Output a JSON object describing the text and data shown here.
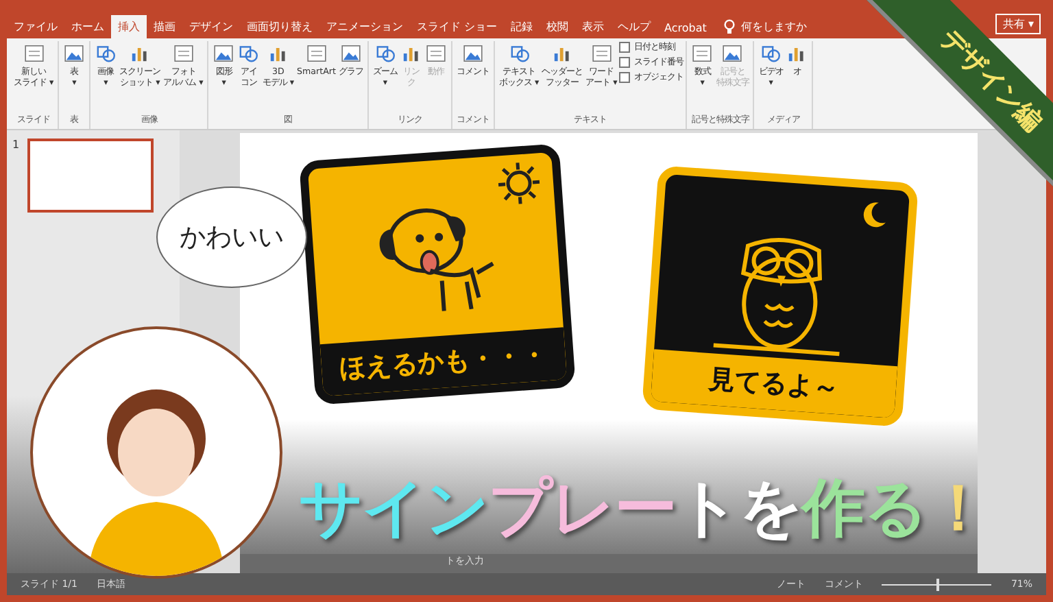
{
  "window": {
    "tell_me": "何をしますか",
    "share_button": "共有 ▾"
  },
  "tabs": [
    {
      "label": "ファイル",
      "selected": false
    },
    {
      "label": "ホーム",
      "selected": false
    },
    {
      "label": "挿入",
      "selected": true
    },
    {
      "label": "描画",
      "selected": false
    },
    {
      "label": "デザイン",
      "selected": false
    },
    {
      "label": "画面切り替え",
      "selected": false
    },
    {
      "label": "アニメーション",
      "selected": false
    },
    {
      "label": "スライド ショー",
      "selected": false
    },
    {
      "label": "記録",
      "selected": false
    },
    {
      "label": "校閲",
      "selected": false
    },
    {
      "label": "表示",
      "selected": false
    },
    {
      "label": "ヘルプ",
      "selected": false
    },
    {
      "label": "Acrobat",
      "selected": false
    }
  ],
  "ribbon": {
    "groups": [
      {
        "label": "スライド",
        "buttons": [
          {
            "lines": [
              "新しい",
              "スライド ▾"
            ],
            "kind": "large",
            "disabled": false
          }
        ]
      },
      {
        "label": "表",
        "buttons": [
          {
            "lines": [
              "表",
              "▾"
            ],
            "kind": "large",
            "disabled": false
          }
        ]
      },
      {
        "label": "画像",
        "buttons": [
          {
            "lines": [
              "画像",
              "▾"
            ],
            "kind": "large",
            "disabled": false
          },
          {
            "lines": [
              "スクリーン",
              "ショット ▾"
            ],
            "kind": "large",
            "disabled": false
          },
          {
            "lines": [
              "フォト",
              "アルバム ▾"
            ],
            "kind": "large",
            "disabled": false
          }
        ]
      },
      {
        "label": "図",
        "buttons": [
          {
            "lines": [
              "図形",
              "▾"
            ],
            "kind": "large",
            "disabled": false
          },
          {
            "lines": [
              "アイ",
              "コン"
            ],
            "kind": "large",
            "disabled": false
          },
          {
            "lines": [
              "3D",
              "モデル ▾"
            ],
            "kind": "large",
            "disabled": false
          },
          {
            "lines": [
              "SmartArt"
            ],
            "kind": "large",
            "disabled": false
          },
          {
            "lines": [
              "グラフ"
            ],
            "kind": "large",
            "disabled": false
          }
        ]
      },
      {
        "label": "リンク",
        "buttons": [
          {
            "lines": [
              "ズーム",
              "▾"
            ],
            "kind": "large",
            "disabled": false
          },
          {
            "lines": [
              "リン",
              "ク"
            ],
            "kind": "large",
            "disabled": true
          },
          {
            "lines": [
              "動作"
            ],
            "kind": "large",
            "disabled": true
          }
        ]
      },
      {
        "label": "コメント",
        "buttons": [
          {
            "lines": [
              "コメント"
            ],
            "kind": "large",
            "disabled": false
          }
        ]
      },
      {
        "label": "テキスト",
        "buttons": [
          {
            "lines": [
              "テキスト",
              "ボックス ▾"
            ],
            "kind": "large",
            "disabled": false
          },
          {
            "lines": [
              "ヘッダーと",
              "フッター"
            ],
            "kind": "large",
            "disabled": false
          },
          {
            "lines": [
              "ワード",
              "アート ▾"
            ],
            "kind": "large",
            "disabled": false
          },
          {
            "lines": [
              "日付と時刻"
            ],
            "kind": "small",
            "disabled": false
          },
          {
            "lines": [
              "スライド番号"
            ],
            "kind": "small",
            "disabled": false
          },
          {
            "lines": [
              "オブジェクト"
            ],
            "kind": "small",
            "disabled": false
          }
        ]
      },
      {
        "label": "記号と特殊文字",
        "buttons": [
          {
            "lines": [
              "数式",
              "▾"
            ],
            "kind": "large",
            "disabled": false
          },
          {
            "lines": [
              "記号と",
              "特殊文字"
            ],
            "kind": "large",
            "disabled": true
          }
        ]
      },
      {
        "label": "メディア",
        "buttons": [
          {
            "lines": [
              "ビデオ",
              "▾"
            ],
            "kind": "large",
            "disabled": false
          },
          {
            "lines": [
              "オ"
            ],
            "kind": "large",
            "disabled": false
          }
        ]
      }
    ]
  },
  "slide_pane": {
    "number": "1"
  },
  "slide": {
    "signs": [
      {
        "kind": "dog",
        "caption": "ほえるかも・・・"
      },
      {
        "kind": "owl",
        "caption": "見てるよ～"
      }
    ]
  },
  "notes_text": "トを入力",
  "speech_bubble": "かわいい",
  "title": {
    "segments": [
      {
        "text": "サイン",
        "color": "#5ee8f0"
      },
      {
        "text": "プレー",
        "color": "#f6bcdc"
      },
      {
        "text": "トを",
        "color": "#ffffff"
      },
      {
        "text": "作る",
        "color": "#9be39b"
      },
      {
        "text": "！",
        "color": "#f5d978"
      }
    ]
  },
  "banner": "デザイン編",
  "status_bar": {
    "slide": "スライド 1/1",
    "language": "日本語",
    "notes": "ノート",
    "comments": "コメント",
    "zoom": "71%",
    "zoom_slider": {
      "level": 0.5
    }
  }
}
